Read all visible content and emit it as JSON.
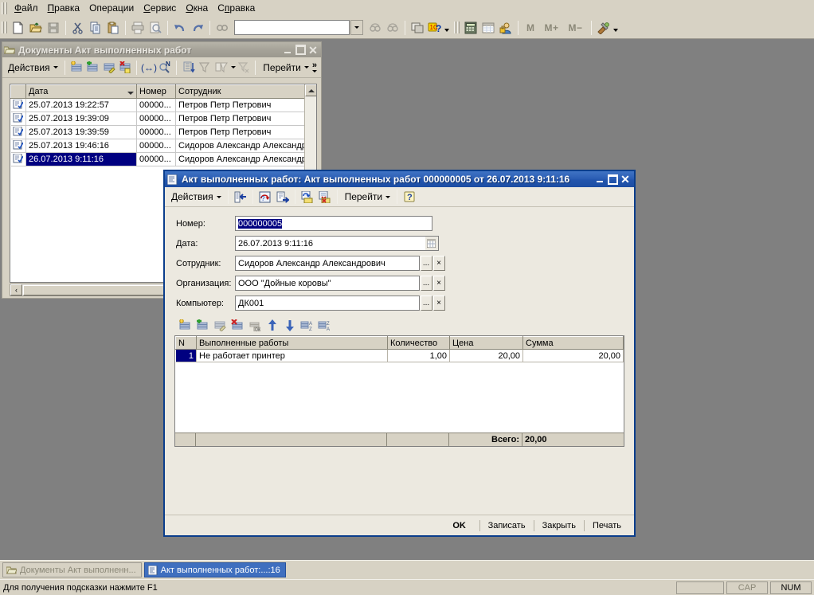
{
  "menubar": {
    "items": [
      {
        "label": "Файл",
        "accel": "Ф"
      },
      {
        "label": "Правка",
        "accel": "П"
      },
      {
        "label": "Операции",
        "accel": "О"
      },
      {
        "label": "Сервис",
        "accel": "С"
      },
      {
        "label": "Окна",
        "accel": "О"
      },
      {
        "label": "Справка",
        "accel": "п"
      }
    ]
  },
  "toolbar": {
    "buttons": [
      {
        "name": "new-document-icon",
        "title": "Новый"
      },
      {
        "name": "open-folder-icon",
        "title": "Открыть"
      },
      {
        "name": "save-icon",
        "title": "Сохранить"
      },
      {
        "name": "cut-icon",
        "title": "Вырезать"
      },
      {
        "name": "copy-icon",
        "title": "Копировать"
      },
      {
        "name": "paste-icon",
        "title": "Вставить"
      },
      {
        "name": "print-icon",
        "title": "Печать"
      },
      {
        "name": "print-preview-icon",
        "title": "Предварительный просмотр"
      },
      {
        "name": "undo-icon",
        "title": "Отменить"
      },
      {
        "name": "redo-icon",
        "title": "Вернуть"
      },
      {
        "name": "find-icon",
        "title": "Найти"
      }
    ],
    "search_value": "",
    "search_placeholder": "",
    "find-next-icon": "Найти следующий",
    "find-prev-icon": "Найти предыдущий",
    "windows-icon": "Окна",
    "help-1c-icon": "Справка 1С",
    "calculator-icon": "Калькулятор",
    "calendar-icon": "Календарь",
    "user-icon": "Пользователь",
    "memory_labels": [
      "M",
      "M+",
      "M−"
    ],
    "tools-icon": "Настройка"
  },
  "list_window": {
    "title": "Документы Акт выполненных работ",
    "icon": "folder-documents-icon",
    "actions_label": "Действия",
    "goto_label": "Перейти",
    "toolbar_icons": [
      "add-record-icon",
      "copy-record-icon",
      "edit-record-icon",
      "delete-record-icon",
      "autowidth-icon",
      "find-by-number-icon",
      "sort-icon",
      "filter-off-icon",
      "filter-by-value-icon",
      "filter-clear-icon"
    ],
    "columns": [
      "",
      "Дата",
      "Номер",
      "Сотрудник"
    ],
    "rows": [
      {
        "icon": "document-icon",
        "date": "25.07.2013 19:22:57",
        "number": "00000...",
        "employee": "Петров Петр Петрович",
        "selected": false
      },
      {
        "icon": "document-icon",
        "date": "25.07.2013 19:39:09",
        "number": "00000...",
        "employee": "Петров Петр Петрович",
        "selected": false
      },
      {
        "icon": "document-icon",
        "date": "25.07.2013 19:39:59",
        "number": "00000...",
        "employee": "Петров Петр Петрович",
        "selected": false
      },
      {
        "icon": "document-icon",
        "date": "25.07.2013 19:46:16",
        "number": "00000...",
        "employee": "Сидоров Александр Александрович",
        "selected": false
      },
      {
        "icon": "document-icon",
        "date": "26.07.2013 9:11:16",
        "number": "00000...",
        "employee": "Сидоров Александр Александрович",
        "selected": true
      }
    ]
  },
  "doc_window": {
    "title": "Акт выполненных работ: Акт выполненных работ 000000005 от 26.07.2013 9:11:16",
    "icon": "document-form-icon",
    "actions_label": "Действия",
    "goto_label": "Перейти",
    "help_label": "?",
    "toolbar_icons": [
      "post-and-close-icon",
      "reread-icon",
      "post-icon",
      "movements-icon",
      "undo-posting-icon"
    ],
    "fields": [
      {
        "label": "Номер:",
        "value": "000000005",
        "selected": true,
        "kind": "text"
      },
      {
        "label": "Дата:",
        "value": "26.07.2013  9:11:16",
        "selected": false,
        "kind": "date"
      },
      {
        "label": "Сотрудник:",
        "value": "Сидоров Александр Александрович",
        "selected": false,
        "kind": "picker"
      },
      {
        "label": "Организация:",
        "value": "ООО \"Дойные коровы\"",
        "selected": false,
        "kind": "picker"
      },
      {
        "label": "Компьютер:",
        "value": "ДК001",
        "selected": false,
        "kind": "picker"
      }
    ],
    "picker_ellipsis": "...",
    "picker_clear": "×",
    "table_toolbar_icons": [
      "add-row-icon",
      "insert-row-icon",
      "edit-row-icon",
      "delete-row-icon",
      "end-edit-icon",
      "move-up-icon",
      "move-down-icon",
      "sort-asc-icon",
      "sort-desc-icon"
    ],
    "table": {
      "columns": [
        "N",
        "Выполненные работы",
        "Количество",
        "Цена",
        "Сумма"
      ],
      "rows": [
        {
          "n": "1",
          "work": "Не работает принтер",
          "qty": "1,00",
          "price": "20,00",
          "sum": "20,00"
        }
      ],
      "footer_label": "Всего:",
      "footer_total": "20,00"
    },
    "buttons": [
      {
        "label": "OK",
        "default": true
      },
      {
        "label": "Записать",
        "default": false
      },
      {
        "label": "Закрыть",
        "default": false
      },
      {
        "label": "Печать",
        "default": false
      }
    ]
  },
  "taskbar": {
    "items": [
      {
        "label": "Документы Акт выполненн...",
        "icon": "folder-documents-icon",
        "active": false
      },
      {
        "label": "Акт выполненных работ:...:16",
        "icon": "document-form-icon",
        "active": true
      }
    ]
  },
  "statusbar": {
    "hint": "Для получения подсказки нажмите F1",
    "panes": [
      {
        "label": "",
        "dim": false,
        "blank": true
      },
      {
        "label": "CAP",
        "dim": true,
        "blank": false
      },
      {
        "label": "NUM",
        "dim": false,
        "blank": false
      }
    ]
  },
  "colors": {
    "window_face": "#d7d2c4",
    "dialog_face": "#ece9e0",
    "active_title": "#2c5fb5",
    "inactive_title": "#a5a298",
    "selection": "#000080",
    "desktop": "#808080"
  }
}
